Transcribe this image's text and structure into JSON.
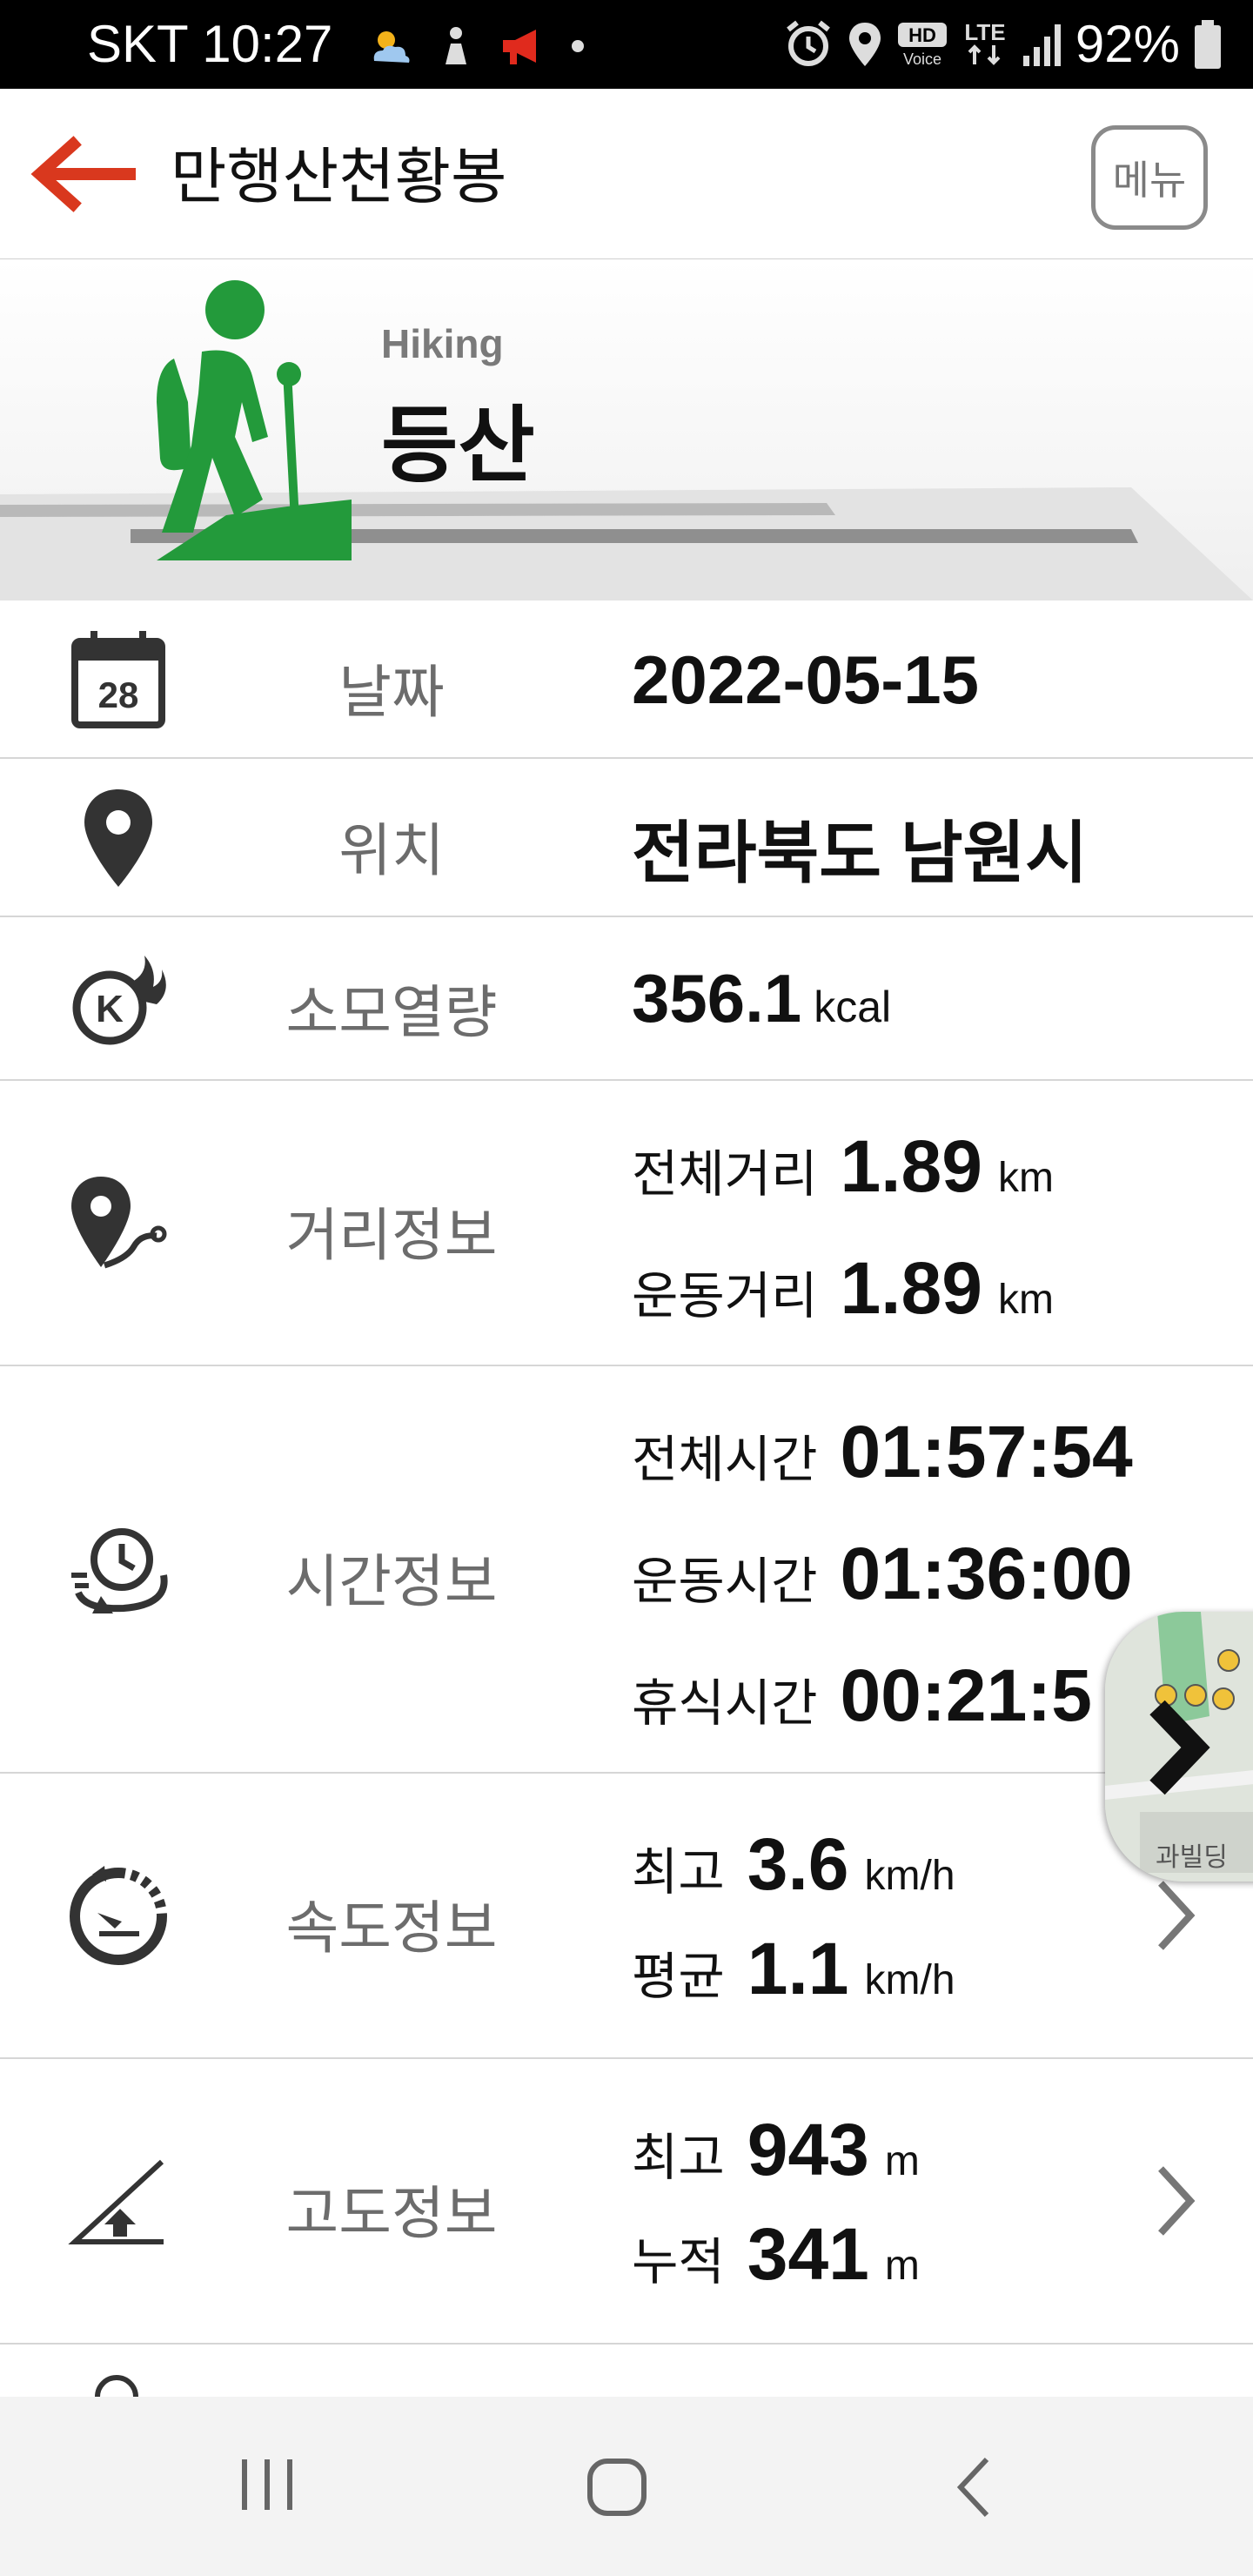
{
  "status_bar": {
    "carrier_time": "SKT 10:27",
    "battery_percent": "92%",
    "icons": [
      "weather-icon",
      "app-icon",
      "megaphone-icon",
      "dot-icon",
      "alarm-icon",
      "location-icon",
      "hd-voice-icon",
      "lte-icon",
      "signal-icon",
      "battery-icon"
    ]
  },
  "app_bar": {
    "title": "만행산천황봉",
    "menu_label": "메뉴",
    "back_color": "#d9381e"
  },
  "hero": {
    "activity_en": "Hiking",
    "activity_ko": "등산",
    "icon_color": "#239a3b"
  },
  "calendar_day": "28",
  "rows": {
    "date": {
      "label": "날짜",
      "value": "2022-05-15"
    },
    "location": {
      "label": "위치",
      "value": "전라북도 남원시"
    },
    "calories": {
      "label": "소모열량",
      "value": "356.1",
      "unit": "kcal"
    },
    "distance": {
      "label": "거리정보",
      "lines": [
        {
          "key": "전체거리",
          "value": "1.89",
          "unit": "km"
        },
        {
          "key": "운동거리",
          "value": "1.89",
          "unit": "km"
        }
      ]
    },
    "time": {
      "label": "시간정보",
      "lines": [
        {
          "key": "전체시간",
          "value": "01:57:54"
        },
        {
          "key": "운동시간",
          "value": "01:36:00"
        },
        {
          "key": "휴식시간",
          "value": "00:21:5"
        }
      ]
    },
    "speed": {
      "label": "속도정보",
      "lines": [
        {
          "key": "최고",
          "value": "3.6",
          "unit": "km/h"
        },
        {
          "key": "평균",
          "value": "1.1",
          "unit": "km/h"
        }
      ]
    },
    "altitude": {
      "label": "고도정보",
      "lines": [
        {
          "key": "최고",
          "value": "943",
          "unit": "m"
        },
        {
          "key": "누적",
          "value": "341",
          "unit": "m"
        }
      ]
    }
  },
  "map_button": {
    "text": "과빌딩"
  }
}
